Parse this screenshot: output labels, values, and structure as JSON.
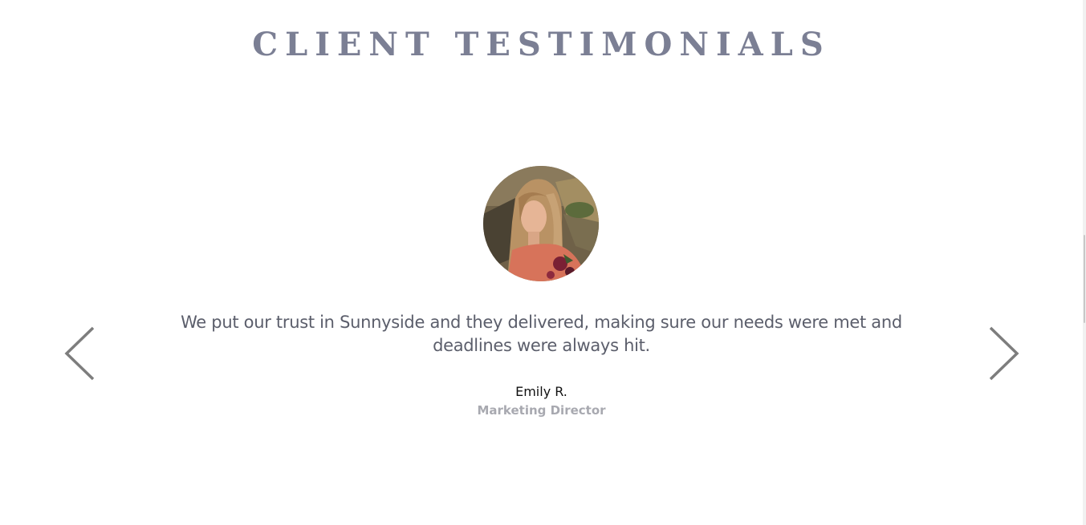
{
  "section": {
    "title": "CLIENT TESTIMONIALS"
  },
  "carousel": {
    "prev_icon": "chevron-left-icon",
    "next_icon": "chevron-right-icon",
    "arrow_color": "#7d7d7d",
    "active_slide": {
      "avatar_icon": "person-photo",
      "quote": "We put our trust in Sunnyside and they delivered, making sure our needs were met and deadlines were always hit.",
      "author_name": "Emily R.",
      "author_role": "Marketing Director"
    }
  },
  "colors": {
    "title": "#7b7f94",
    "quote": "#5b5e6b",
    "author_name": "#111111",
    "author_role": "#a8a9b0"
  }
}
